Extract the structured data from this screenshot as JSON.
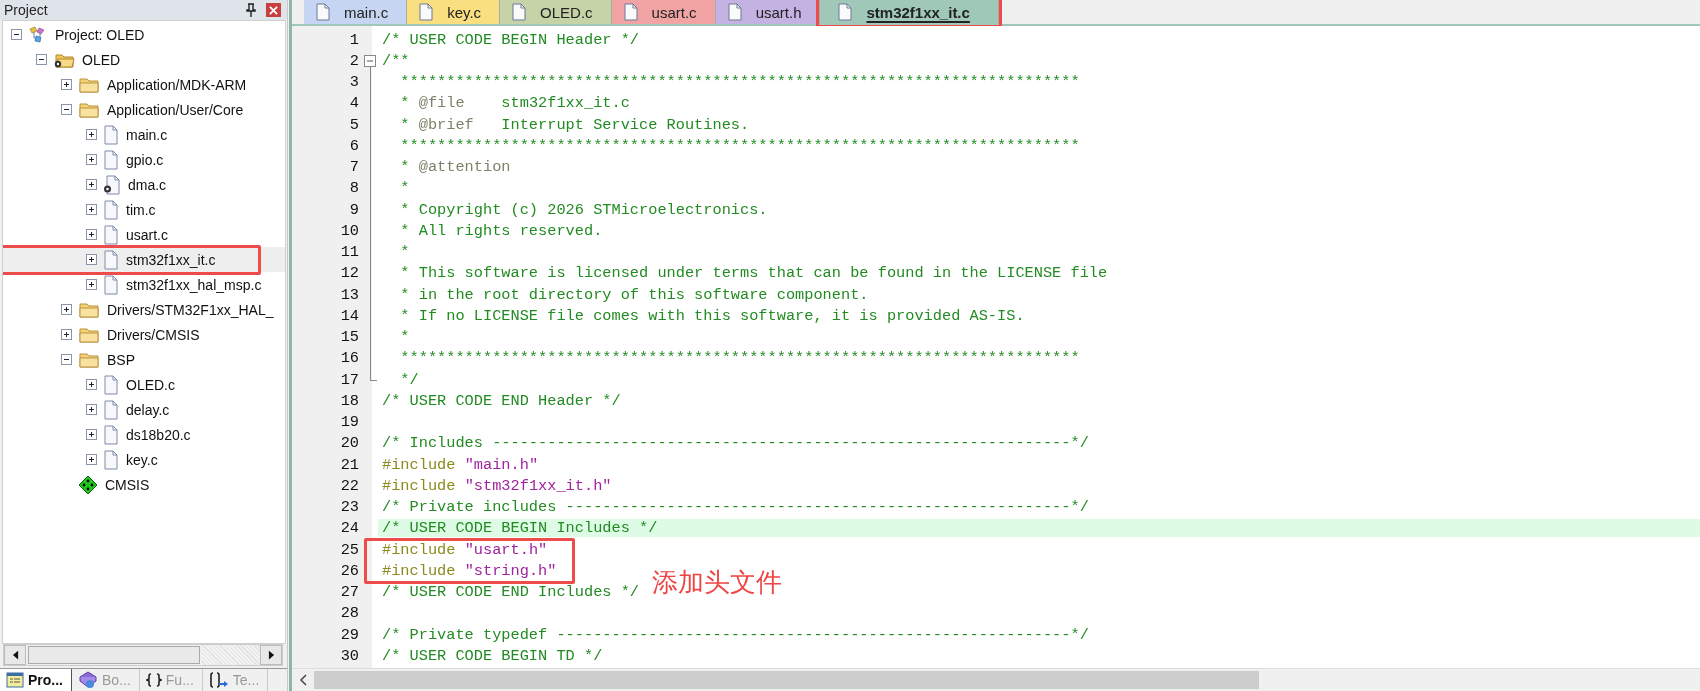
{
  "project_panel": {
    "title": "Project",
    "tree": [
      {
        "label": "Project: OLED",
        "kind": "project",
        "expanded": true,
        "children": [
          {
            "label": "OLED",
            "kind": "target",
            "expanded": true,
            "children": [
              {
                "label": "Application/MDK-ARM",
                "kind": "folder",
                "expanded": false
              },
              {
                "label": "Application/User/Core",
                "kind": "folder",
                "expanded": true,
                "children": [
                  {
                    "label": "main.c",
                    "kind": "file",
                    "expanded": false
                  },
                  {
                    "label": "gpio.c",
                    "kind": "file",
                    "expanded": false
                  },
                  {
                    "label": "dma.c",
                    "kind": "file-options",
                    "expanded": false
                  },
                  {
                    "label": "tim.c",
                    "kind": "file",
                    "expanded": false
                  },
                  {
                    "label": "usart.c",
                    "kind": "file",
                    "expanded": false
                  },
                  {
                    "label": "stm32f1xx_it.c",
                    "kind": "file",
                    "expanded": false,
                    "selected": true,
                    "boxed": true
                  },
                  {
                    "label": "stm32f1xx_hal_msp.c",
                    "kind": "file",
                    "expanded": false
                  }
                ]
              },
              {
                "label": "Drivers/STM32F1xx_HAL_",
                "kind": "folder",
                "expanded": false
              },
              {
                "label": "Drivers/CMSIS",
                "kind": "folder",
                "expanded": false
              },
              {
                "label": "BSP",
                "kind": "folder",
                "expanded": true,
                "children": [
                  {
                    "label": "OLED.c",
                    "kind": "file",
                    "expanded": false
                  },
                  {
                    "label": "delay.c",
                    "kind": "file",
                    "expanded": false
                  },
                  {
                    "label": "ds18b20.c",
                    "kind": "file",
                    "expanded": false
                  },
                  {
                    "label": "key.c",
                    "kind": "file",
                    "expanded": false
                  }
                ]
              },
              {
                "label": "CMSIS",
                "kind": "component"
              }
            ]
          }
        ]
      }
    ],
    "bottom_tabs": [
      {
        "label": "Pro...",
        "kind": "project-window",
        "selected": true
      },
      {
        "label": "Bo...",
        "kind": "books",
        "selected": false
      },
      {
        "label": "Fu...",
        "kind": "braces",
        "selected": false
      },
      {
        "label": "Te...",
        "kind": "template",
        "selected": false
      }
    ]
  },
  "editor_tabs": [
    {
      "label": "main.c",
      "color": "#c6d6f2",
      "selected": false,
      "boxed": false
    },
    {
      "label": "key.c",
      "color": "#f9df80",
      "selected": false,
      "boxed": false
    },
    {
      "label": "OLED.c",
      "color": "#c5d3a6",
      "selected": false,
      "boxed": false
    },
    {
      "label": "usart.c",
      "color": "#f2a4a4",
      "selected": false,
      "boxed": false
    },
    {
      "label": "usart.h",
      "color": "#c4b2e2",
      "selected": false,
      "boxed": false
    },
    {
      "label": "stm32f1xx_it.c",
      "color": "#9fc8b8",
      "selected": true,
      "boxed": true
    }
  ],
  "code_lines": [
    {
      "number": "1",
      "segments": [
        {
          "kind": "comment",
          "text": "/* USER CODE BEGIN Header */"
        }
      ]
    },
    {
      "number": "2",
      "kind": "fold-start",
      "segments": [
        {
          "kind": "comment",
          "text": "/**"
        }
      ]
    },
    {
      "number": "3",
      "kind": "fold-body",
      "segments": [
        {
          "kind": "comment",
          "text": "  **************************************************************************"
        }
      ]
    },
    {
      "number": "4",
      "kind": "fold-body",
      "segments": [
        {
          "kind": "comment",
          "text": "  * "
        },
        {
          "kind": "doc-tag",
          "text": "@file"
        },
        {
          "kind": "comment",
          "text": "    stm32f1xx_it.c"
        }
      ]
    },
    {
      "number": "5",
      "kind": "fold-body",
      "segments": [
        {
          "kind": "comment",
          "text": "  * "
        },
        {
          "kind": "doc-tag",
          "text": "@brief"
        },
        {
          "kind": "comment",
          "text": "   Interrupt Service Routines."
        }
      ]
    },
    {
      "number": "6",
      "kind": "fold-body",
      "segments": [
        {
          "kind": "comment",
          "text": "  **************************************************************************"
        }
      ]
    },
    {
      "number": "7",
      "kind": "fold-body",
      "segments": [
        {
          "kind": "comment",
          "text": "  * "
        },
        {
          "kind": "doc-tag",
          "text": "@attention"
        }
      ]
    },
    {
      "number": "8",
      "kind": "fold-body",
      "segments": [
        {
          "kind": "comment",
          "text": "  *"
        }
      ]
    },
    {
      "number": "9",
      "kind": "fold-body",
      "segments": [
        {
          "kind": "comment",
          "text": "  * Copyright (c) 2026 STMicroelectronics."
        }
      ]
    },
    {
      "number": "10",
      "kind": "fold-body",
      "segments": [
        {
          "kind": "comment",
          "text": "  * All rights reserved."
        }
      ]
    },
    {
      "number": "11",
      "kind": "fold-body",
      "segments": [
        {
          "kind": "comment",
          "text": "  *"
        }
      ]
    },
    {
      "number": "12",
      "kind": "fold-body",
      "segments": [
        {
          "kind": "comment",
          "text": "  * This software is licensed under terms that can be found in the LICENSE file"
        }
      ]
    },
    {
      "number": "13",
      "kind": "fold-body",
      "segments": [
        {
          "kind": "comment",
          "text": "  * in the root directory of this software component."
        }
      ]
    },
    {
      "number": "14",
      "kind": "fold-body",
      "segments": [
        {
          "kind": "comment",
          "text": "  * If no LICENSE file comes with this software, it is provided AS-IS."
        }
      ]
    },
    {
      "number": "15",
      "kind": "fold-body",
      "segments": [
        {
          "kind": "comment",
          "text": "  *"
        }
      ]
    },
    {
      "number": "16",
      "kind": "fold-body",
      "segments": [
        {
          "kind": "comment",
          "text": "  **************************************************************************"
        }
      ]
    },
    {
      "number": "17",
      "kind": "fold-end",
      "segments": [
        {
          "kind": "comment",
          "text": "  */"
        }
      ]
    },
    {
      "number": "18",
      "segments": [
        {
          "kind": "comment",
          "text": "/* USER CODE END Header */"
        }
      ]
    },
    {
      "number": "19"
    },
    {
      "number": "20",
      "segments": [
        {
          "kind": "comment",
          "text": "/* Includes ---------------------------------------------------------------*/"
        }
      ]
    },
    {
      "number": "21",
      "segments": [
        {
          "kind": "preproc",
          "text": "#include "
        },
        {
          "kind": "string",
          "text": "\"main.h\""
        }
      ]
    },
    {
      "number": "22",
      "segments": [
        {
          "kind": "preproc",
          "text": "#include "
        },
        {
          "kind": "string",
          "text": "\"stm32f1xx_it.h\""
        }
      ]
    },
    {
      "number": "23",
      "segments": [
        {
          "kind": "comment",
          "text": "/* Private includes -------------------------------------------------------*/"
        }
      ]
    },
    {
      "number": "24",
      "highlighted": true,
      "segments": [
        {
          "kind": "comment",
          "text": "/* USER CODE BEGIN Includes */"
        }
      ]
    },
    {
      "number": "25",
      "boxed": true,
      "segments": [
        {
          "kind": "preproc",
          "text": "#include "
        },
        {
          "kind": "string",
          "text": "\"usart.h\""
        }
      ]
    },
    {
      "number": "26",
      "boxed": true,
      "segments": [
        {
          "kind": "preproc",
          "text": "#include "
        },
        {
          "kind": "string",
          "text": "\"string.h\""
        }
      ]
    },
    {
      "number": "27",
      "segments": [
        {
          "kind": "comment",
          "text": "/* USER CODE END Includes */"
        }
      ]
    },
    {
      "number": "28"
    },
    {
      "number": "29",
      "segments": [
        {
          "kind": "comment",
          "text": "/* Private typedef --------------------------------------------------------*/"
        }
      ]
    },
    {
      "number": "30",
      "segments": [
        {
          "kind": "comment",
          "text": "/* USER CODE BEGIN TD */"
        }
      ]
    }
  ],
  "annotation": {
    "text": "添加头文件"
  }
}
